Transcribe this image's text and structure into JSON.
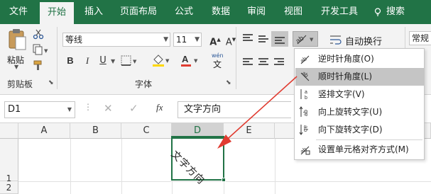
{
  "tabs": [
    "文件",
    "开始",
    "插入",
    "页面布局",
    "公式",
    "数据",
    "审阅",
    "视图",
    "开发工具",
    "搜索"
  ],
  "ribbon": {
    "paste_label": "粘贴",
    "clipboard_label": "剪贴板",
    "font_name": "等线",
    "font_size": "11",
    "font_group_label": "字体",
    "bold": "B",
    "italic": "I",
    "underline": "U",
    "wrap_text_label": "自动换行",
    "number_format": "常规",
    "wen_label": "wén",
    "wen_char": "文"
  },
  "formula_bar": {
    "name_box": "D1",
    "fx": "fx",
    "content": "文字方向"
  },
  "grid": {
    "columns": [
      "A",
      "B",
      "C",
      "D",
      "E"
    ],
    "rows": [
      "1",
      "2"
    ],
    "cell_d1_text": "文字方向"
  },
  "orientation_menu": {
    "items": [
      {
        "label": "逆时针角度(O)",
        "icon": "angle-counterclockwise-icon"
      },
      {
        "label": "顺时针角度(L)",
        "icon": "angle-clockwise-icon"
      },
      {
        "label": "竖排文字(V)",
        "icon": "vertical-text-icon"
      },
      {
        "label": "向上旋转文字(U)",
        "icon": "rotate-text-up-icon"
      },
      {
        "label": "向下旋转文字(D)",
        "icon": "rotate-text-down-icon"
      },
      {
        "label": "设置单元格对齐方式(M)",
        "icon": "format-cell-alignment-icon"
      }
    ]
  },
  "colors": {
    "accent": "#217346",
    "annotation_arrow": "#e03c31"
  }
}
